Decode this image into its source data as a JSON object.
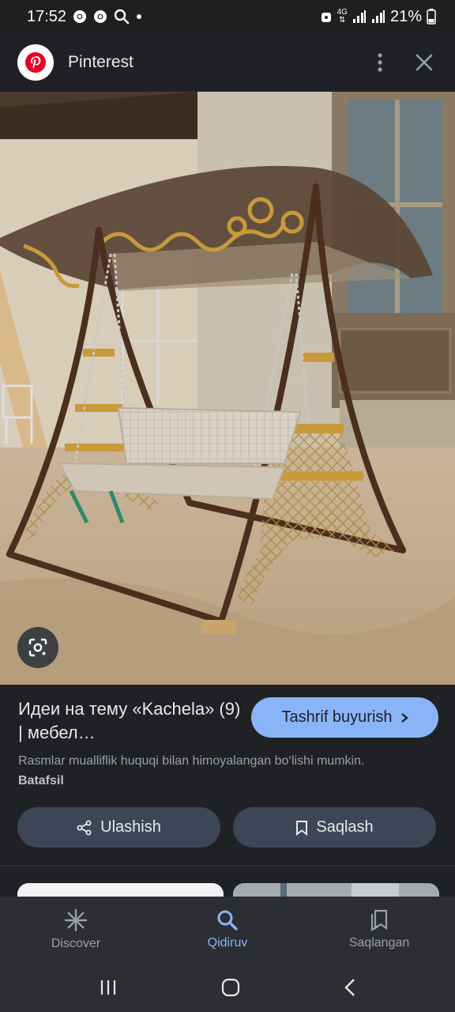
{
  "status_bar": {
    "time": "17:52",
    "notification_icons": [
      "chrome-icon",
      "chrome-icon",
      "search-icon",
      "dot-icon"
    ],
    "battery": "21%",
    "network": "4G"
  },
  "header": {
    "site_name": "Pinterest",
    "logo_icon": "pinterest-logo-icon",
    "more_icon": "more-vert-icon",
    "close_icon": "close-icon"
  },
  "image": {
    "lens_icon": "google-lens-icon"
  },
  "result": {
    "title": "Идеи на тему «Kachela» (9) | мебел…",
    "visit_label": "Tashrif buyurish",
    "copyright_text": "Rasmlar mualliflik huquqi bilan himoyalangan bo‘lishi mumkin.",
    "copyright_link": "Batafsil",
    "share_label": "Ulashish",
    "save_label": "Saqlash"
  },
  "bottom_nav": {
    "items": [
      {
        "label": "Discover",
        "icon": "asterisk-icon",
        "active": false
      },
      {
        "label": "Qidiruv",
        "icon": "search-icon",
        "active": true
      },
      {
        "label": "Saqlangan",
        "icon": "bookmarks-icon",
        "active": false
      }
    ]
  },
  "colors": {
    "background": "#202124",
    "accent": "#8ab4f8",
    "button_bg": "#3c4657",
    "nav_bg": "#2d2e31",
    "pinterest_red": "#e60023"
  }
}
